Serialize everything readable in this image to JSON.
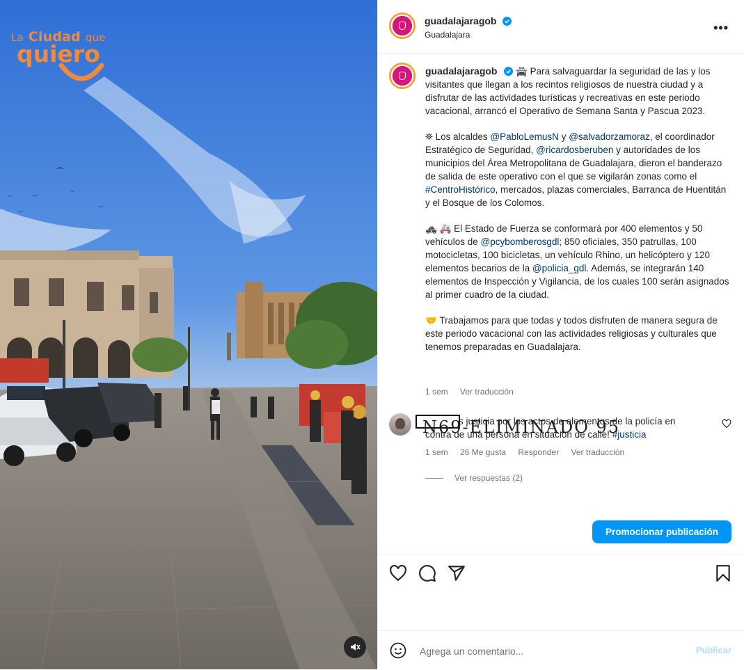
{
  "post": {
    "username": "guadalajaragob",
    "location": "Guadalajara",
    "media": {
      "logo_line1_a": "La",
      "logo_line1_b": "Ciudad",
      "logo_line1_c": "que",
      "logo_line2": "quiero"
    },
    "caption": {
      "p1_icon": "🚔",
      "p1": "Para salvaguardar la seguridad de las y los visitantes que llegan a los recintos religiosos de nuestra ciudad y a disfrutar de las actividades turísticas y recreativas en este periodo vacacional, arrancó el Operativo de Semana Santa y Pascua 2023.",
      "p2_icon": "⛯",
      "p2_a": "Los alcaldes",
      "p2_m1": "@PabloLemusN",
      "p2_b": "y",
      "p2_m2": "@salvadorzamoraz",
      "p2_c": ", el coordinador Estratégico de Seguridad,",
      "p2_m3": "@ricardosberuben",
      "p2_d": "y autoridades de los municipios del Área Metropolitana de Guadalajara, dieron el banderazo de salida de este operativo con el que se vigilarán zonas como el",
      "p2_tag": "#CentroHistórico",
      "p2_e": ", mercados, plazas comerciales, Barranca de Huentitán y el Bosque de los Colomos.",
      "p3_icons": "🚓 🚑",
      "p3_a": "El Estado de Fuerza se conformará por 400 elementos y 50 vehículos de",
      "p3_m1": "@pcybomberosgdl",
      "p3_b": "; 850 oficiales, 350 patrullas, 100 motocicletas, 100 bicicletas, un vehículo Rhino, un helicóptero y 120 elementos becarios de la",
      "p3_m2": "@policia_gdl",
      "p3_c": ". Además, se integrarán 140 elementos de Inspección y Vigilancia, de los cuales 100 serán asignados al primer cuadro de la ciudad.",
      "p4_icon": "🤝",
      "p4": "Trabajamos para que todas y todos disfruten de manera segura de este periodo vacacional con las actividades religiosas y culturales que tenemos preparadas en Guadalajara.",
      "time": "1 sem",
      "see_translation": "Ver traducción"
    },
    "comment": {
      "text_a": "Exigimos justicia por los actos de elementos de la policía en contra de una persona en situación de calle!",
      "tag": "#justicia",
      "overlay": "N69-ELIMINADO 95",
      "time": "1 sem",
      "likes": "26 Me gusta",
      "reply": "Responder",
      "see_translation": "Ver traducción",
      "view_replies": "Ver respuestas (2)"
    },
    "promote_label": "Promocionar publicación",
    "comment_placeholder": "Agrega un comentario...",
    "publish_label": "Publicar"
  },
  "colors": {
    "accent": "#0095f6",
    "link": "#00376b",
    "muted": "#737373",
    "logo_orange": "#f08a3c"
  },
  "icons": [
    "verified-icon",
    "more-icon",
    "heart-icon",
    "comment-icon",
    "share-icon",
    "bookmark-icon",
    "emoji-icon",
    "mute-icon"
  ]
}
